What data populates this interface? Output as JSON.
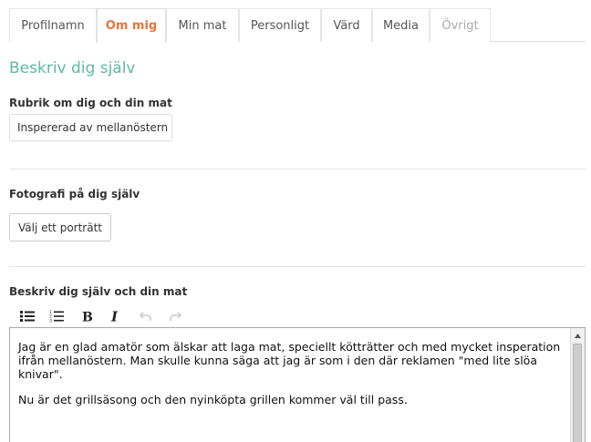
{
  "tabs": [
    {
      "label": "Profilnamn",
      "state": "normal"
    },
    {
      "label": "Om mig",
      "state": "active"
    },
    {
      "label": "Min mat",
      "state": "normal"
    },
    {
      "label": "Personligt",
      "state": "normal"
    },
    {
      "label": "Värd",
      "state": "normal"
    },
    {
      "label": "Media",
      "state": "normal"
    },
    {
      "label": "Övrigt",
      "state": "disabled"
    }
  ],
  "section": {
    "title": "Beskriv dig själv"
  },
  "headline": {
    "label": "Rubrik om dig och din mat",
    "value": "Inspererad av mellanöstern"
  },
  "photo": {
    "label": "Fotografi på dig själv",
    "button_label": "Välj ett porträtt"
  },
  "description": {
    "label": "Beskriv dig själv och din mat",
    "toolbar": [
      "bulleted-list-icon",
      "numbered-list-icon",
      "bold-icon",
      "italic-icon",
      "undo-icon",
      "redo-icon"
    ],
    "paragraphs": [
      "Jag är en glad amatör som älskar att laga mat, speciellt kötträtter och med mycket insperation ifrån mellanöstern. Man skulle kunna säga att jag är som i den där reklamen \"med lite slöa knivar\".",
      "Nu är det grillsäsong och den nyinköpta grillen kommer väl till pass."
    ]
  },
  "colors": {
    "accent": "#e8743b",
    "section_title": "#5fb8a6",
    "disabled": "#aaaaaa"
  }
}
